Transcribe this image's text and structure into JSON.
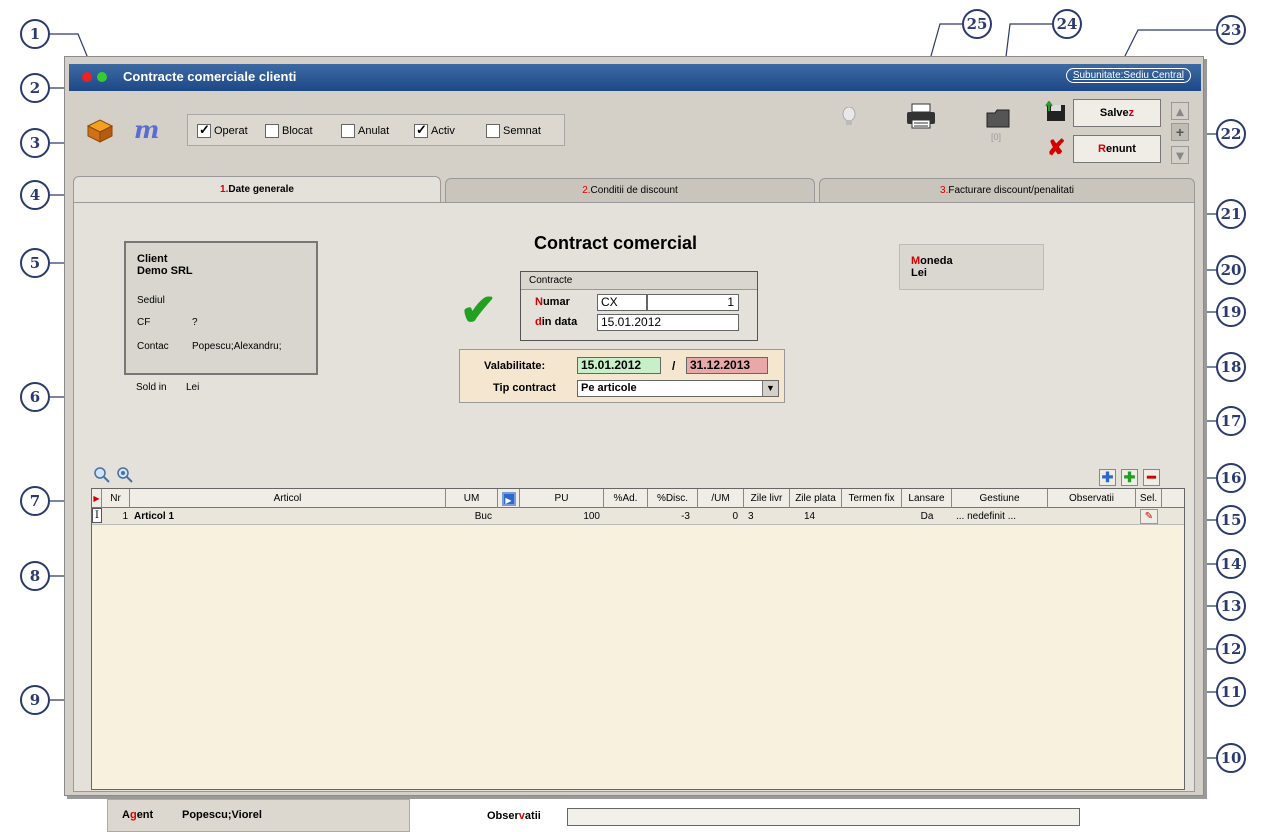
{
  "callouts": [
    "1",
    "2",
    "3",
    "4",
    "5",
    "6",
    "7",
    "8",
    "9",
    "10",
    "11",
    "12",
    "13",
    "14",
    "15",
    "16",
    "17",
    "18",
    "19",
    "20",
    "21",
    "22",
    "23",
    "24",
    "25"
  ],
  "window": {
    "title": "Contracte comerciale clienti",
    "subunit": "Subunitate:Sediu Central"
  },
  "checkboxes": [
    {
      "label": "Operat",
      "checked": true
    },
    {
      "label": "Blocat",
      "checked": false
    },
    {
      "label": "Anulat",
      "checked": false
    },
    {
      "label": "Activ",
      "checked": true
    },
    {
      "label": "Semnat",
      "checked": false
    }
  ],
  "toolbar": {
    "attach_count": "[0]",
    "save_pre": "Salve",
    "save_hl": "z",
    "cancel_hl": "R",
    "cancel_post": "enunt"
  },
  "tabs": {
    "t1_num": "1.",
    "t1_label": " Date generale",
    "t2_num": "2.",
    "t2_label": " Conditii de discount",
    "t3_num": "3.",
    "t3_label": "Facturare discount/penalitati"
  },
  "client": {
    "title": "Client",
    "name": "Demo SRL",
    "sediul_label": "Sediul",
    "cf_label": "CF",
    "cf_value": "?",
    "contact_label": "Contac",
    "contact_value": "Popescu;Alexandru;",
    "sold_label": "Sold in",
    "sold_value": "Lei"
  },
  "contract": {
    "heading": "Contract comercial",
    "box_label": "Contracte",
    "numar_hl": "N",
    "numar_label": "umar",
    "numar_series": "CX",
    "numar_value": "1",
    "data_hl": "d",
    "data_label": "in data",
    "data_value": "15.01.2012"
  },
  "validity": {
    "label": "Valabilitate:",
    "from": "15.01.2012",
    "sep": "/",
    "to": "31.12.2013",
    "tip_label": "Tip contract",
    "tip_value": "Pe articole"
  },
  "currency": {
    "hl": "M",
    "label": "oneda",
    "value": "Lei"
  },
  "grid": {
    "columns": [
      "Nr",
      "Articol",
      "UM",
      "",
      "PU",
      "%Ad.",
      "%Disc.",
      "/UM",
      "Zile livr",
      "Zile plata",
      "Termen fix",
      "Lansare",
      "Gestiune",
      "Observatii",
      "Sel."
    ],
    "row_marker": "I",
    "rows": [
      {
        "nr": "1",
        "articol": "Articol 1",
        "um": "Buc",
        "pu": "100",
        "ad": "",
        "disc": "-3",
        "per_um": "0",
        "zile_livr": "3",
        "zile_plata": "14",
        "termen": "",
        "lansare": "Da",
        "gestiune": "... nedefinit ..."
      }
    ]
  },
  "agent": {
    "hl": "g",
    "label_pre": "A",
    "label_post": "ent",
    "value": "Popescu;Viorel"
  },
  "observatii": {
    "label_pre": "Obser",
    "label_hl": "v",
    "label_post": "atii",
    "value": ""
  }
}
